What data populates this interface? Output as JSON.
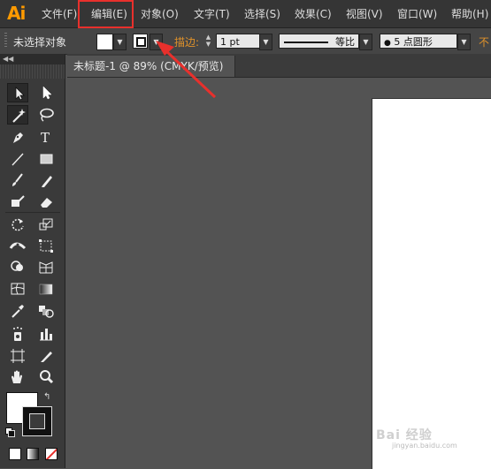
{
  "app": {
    "logo": "Ai"
  },
  "menu": [
    {
      "label": "文件(F)"
    },
    {
      "label": "编辑(E)"
    },
    {
      "label": "对象(O)"
    },
    {
      "label": "文字(T)"
    },
    {
      "label": "选择(S)"
    },
    {
      "label": "效果(C)"
    },
    {
      "label": "视图(V)"
    },
    {
      "label": "窗口(W)"
    },
    {
      "label": "帮助(H)"
    }
  ],
  "control_bar": {
    "selection_status": "未选择对象",
    "stroke_label": "描边:",
    "stroke_weight": "1 pt",
    "stroke_profile": "等比",
    "brush": "5 点圆形",
    "opacity_label_partial": "不"
  },
  "document": {
    "tab_title": "未标题-1 @ 89% (CMYK/预览)"
  },
  "tools": [
    {
      "name": "selection-tool"
    },
    {
      "name": "direct-selection-tool"
    },
    {
      "name": "magic-wand-tool"
    },
    {
      "name": "lasso-tool"
    },
    {
      "name": "pen-tool"
    },
    {
      "name": "type-tool"
    },
    {
      "name": "line-segment-tool"
    },
    {
      "name": "rectangle-tool"
    },
    {
      "name": "paintbrush-tool"
    },
    {
      "name": "pencil-tool"
    },
    {
      "name": "blob-brush-tool"
    },
    {
      "name": "eraser-tool"
    },
    {
      "name": "rotate-tool"
    },
    {
      "name": "scale-tool"
    },
    {
      "name": "width-tool"
    },
    {
      "name": "free-transform-tool"
    },
    {
      "name": "shape-builder-tool"
    },
    {
      "name": "perspective-grid-tool"
    },
    {
      "name": "mesh-tool"
    },
    {
      "name": "gradient-tool"
    },
    {
      "name": "eyedropper-tool"
    },
    {
      "name": "blend-tool"
    },
    {
      "name": "symbol-sprayer-tool"
    },
    {
      "name": "column-graph-tool"
    },
    {
      "name": "artboard-tool"
    },
    {
      "name": "slice-tool"
    },
    {
      "name": "hand-tool"
    },
    {
      "name": "zoom-tool"
    }
  ],
  "watermark": {
    "text": "Bai 经验",
    "sub": "jingyan.baidu.com"
  },
  "colors": {
    "annotation_red": "#e8302c",
    "logo_orange": "#ff9a00",
    "stroke_label_orange": "#e0922a"
  }
}
